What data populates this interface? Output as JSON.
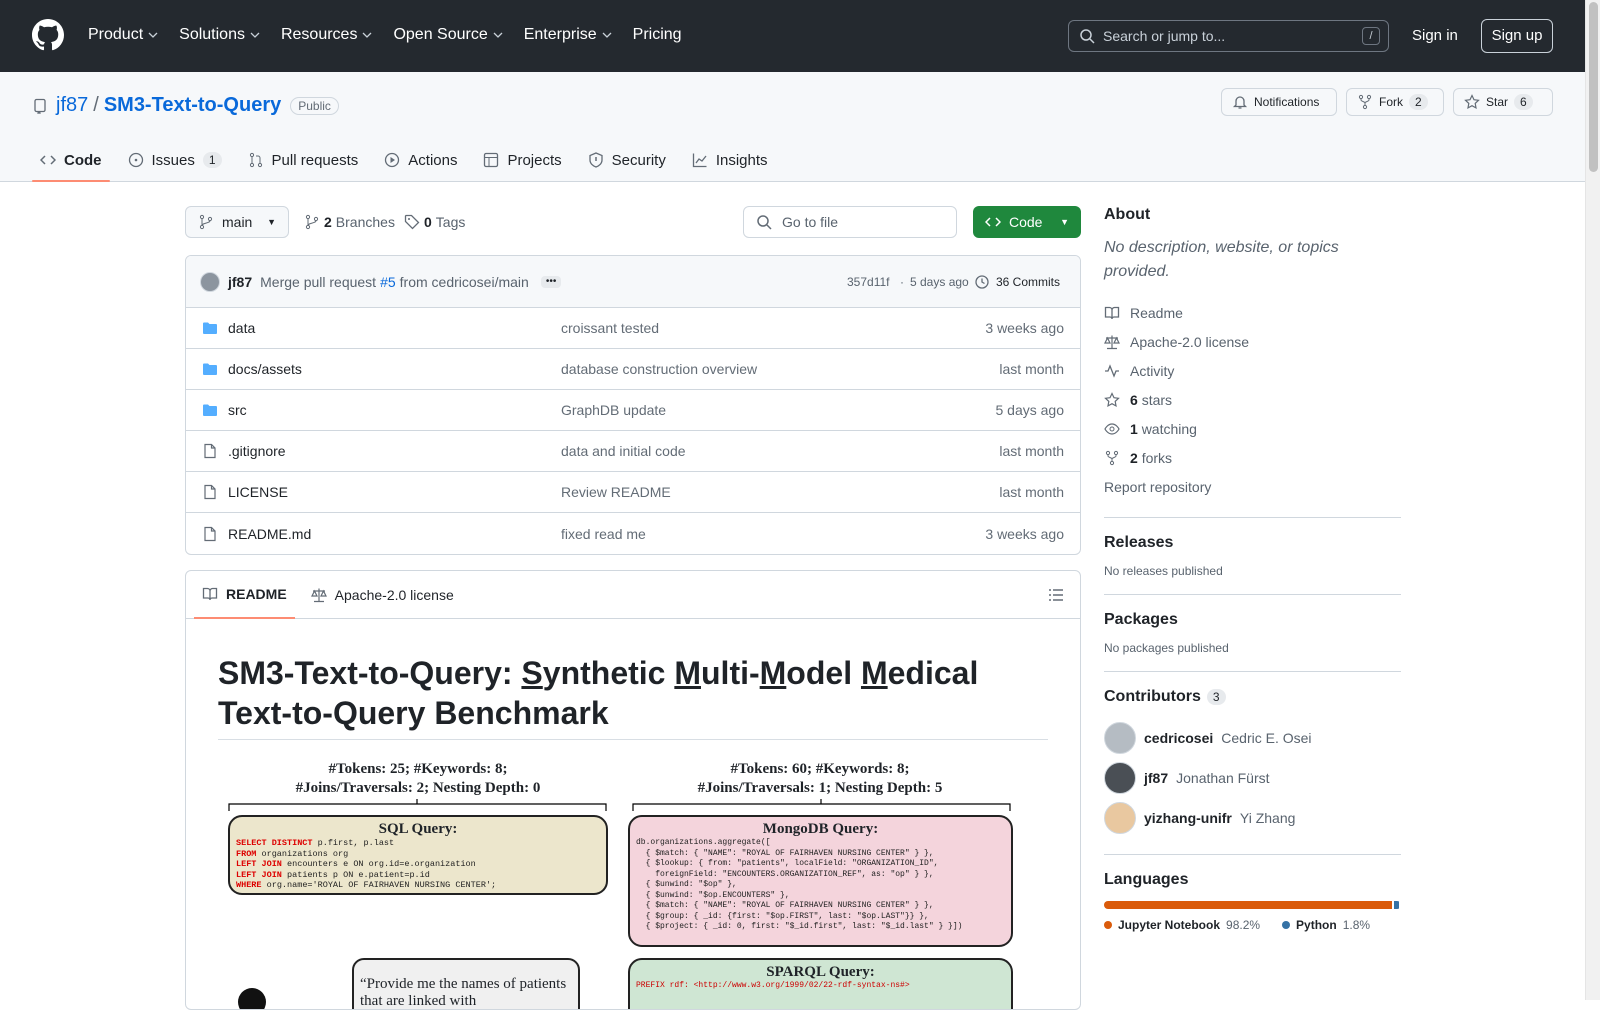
{
  "header": {
    "nav": [
      "Product",
      "Solutions",
      "Resources",
      "Open Source",
      "Enterprise",
      "Pricing"
    ],
    "search_placeholder": "Search or jump to...",
    "search_key": "/",
    "sign_in": "Sign in",
    "sign_up": "Sign up"
  },
  "repo": {
    "owner": "jf87",
    "sep": "/",
    "name": "SM3-Text-to-Query",
    "visibility": "Public",
    "notifications": "Notifications",
    "fork": "Fork",
    "fork_count": "2",
    "star": "Star",
    "star_count": "6"
  },
  "tabs": [
    {
      "label": "Code",
      "icon": "code-icon"
    },
    {
      "label": "Issues",
      "icon": "issue-icon",
      "count": "1"
    },
    {
      "label": "Pull requests",
      "icon": "pr-icon"
    },
    {
      "label": "Actions",
      "icon": "play-icon"
    },
    {
      "label": "Projects",
      "icon": "table-icon"
    },
    {
      "label": "Security",
      "icon": "shield-icon"
    },
    {
      "label": "Insights",
      "icon": "graph-icon"
    }
  ],
  "toolbar": {
    "branch": "main",
    "branches_count": "2",
    "branches_label": "Branches",
    "tags_count": "0",
    "tags_label": "Tags",
    "goto": "Go to file",
    "code": "Code"
  },
  "commit": {
    "author": "jf87",
    "message_prefix": "Merge pull request",
    "pr": "#5",
    "message_suffix": "from cedricosei/main",
    "sha": "357d11f",
    "dot": "·",
    "age": "5 days ago",
    "commits": "36 Commits"
  },
  "files": [
    {
      "name": "data",
      "type": "folder",
      "msg": "croissant tested",
      "age": "3 weeks ago"
    },
    {
      "name": "docs/assets",
      "type": "folder",
      "msg": "database construction overview",
      "age": "last month"
    },
    {
      "name": "src",
      "type": "folder",
      "msg": "GraphDB update",
      "age": "5 days ago"
    },
    {
      "name": ".gitignore",
      "type": "file",
      "msg": "data and initial code",
      "age": "last month"
    },
    {
      "name": "LICENSE",
      "type": "file",
      "msg": "Review README",
      "age": "last month"
    },
    {
      "name": "README.md",
      "type": "file",
      "msg": "fixed read me",
      "age": "3 weeks ago"
    }
  ],
  "readme": {
    "tab1": "README",
    "tab2": "Apache-2.0 license",
    "title_1": "SM3-Text-to-Query: ",
    "title_s": "S",
    "title_2": "ynthetic ",
    "title_m1": "M",
    "title_3": "ulti-",
    "title_m2": "M",
    "title_4": "odel ",
    "title_m3": "M",
    "title_5": "edical",
    "title_line2": "Text-to-Query Benchmark",
    "fig": {
      "left_stats1": "#Tokens: 25;  #Keywords: 8;",
      "left_stats2": "#Joins/Traversals: 2; Nesting Depth: 0",
      "right_stats1": "#Tokens: 60;  #Keywords: 8;",
      "right_stats2": "#Joins/Traversals: 1; Nesting Depth: 5",
      "sql_title": "SQL Query:",
      "sql_lines": [
        "SELECT DISTINCT p.first, p.last",
        "FROM organizations org",
        "LEFT JOIN encounters e ON org.id=e.organization",
        "LEFT JOIN patients p ON e.patient=p.id",
        "WHERE org.name='ROYAL OF FAIRHAVEN NURSING CENTER';"
      ],
      "mongo_title": "MongoDB Query:",
      "mongo_lines": [
        "db.organizations.aggregate([",
        "  { $match: { \"NAME\": \"ROYAL OF FAIRHAVEN NURSING CENTER\" } },",
        "  { $lookup: { from: \"patients\", localField: \"ORGANIZATION_ID\",",
        "    foreignField: \"ENCOUNTERS.ORGANIZATION_REF\", as: \"op\" } },",
        "  { $unwind: \"$op\" },",
        "  { $unwind: \"$op.ENCOUNTERS\" },",
        "  { $match: { \"NAME\": \"ROYAL OF FAIRHAVEN NURSING CENTER\" } },",
        "  { $group: { _id: {first: \"$op.FIRST\", last: \"$op.LAST\"}} },",
        "  { $project: { _id: 0, first: \"$_id.first\", last: \"$_id.last\" } }])"
      ],
      "quote": "“Provide me the names of patients that are linked with",
      "sparql_title": "SPARQL Query:",
      "sparql_line": "PREFIX rdf: <http://www.w3.org/1999/02/22-rdf-syntax-ns#>"
    }
  },
  "about": {
    "title": "About",
    "desc": "No description, website, or topics provided.",
    "links": [
      {
        "icon": "book-icon",
        "label": "Readme"
      },
      {
        "icon": "scale-icon",
        "label": "Apache-2.0 license"
      },
      {
        "icon": "pulse-icon",
        "label": "Activity"
      },
      {
        "icon": "star-icon",
        "count": "6",
        "label": "stars"
      },
      {
        "icon": "eye-icon",
        "count": "1",
        "label": "watching"
      },
      {
        "icon": "fork-icon",
        "count": "2",
        "label": "forks"
      }
    ],
    "report": "Report repository"
  },
  "releases": {
    "title": "Releases",
    "none": "No releases published"
  },
  "packages": {
    "title": "Packages",
    "none": "No packages published"
  },
  "contributors": {
    "title": "Contributors",
    "count": "3",
    "list": [
      {
        "login": "cedricosei",
        "name": "Cedric E. Osei"
      },
      {
        "login": "jf87",
        "name": "Jonathan Fürst"
      },
      {
        "login": "yizhang-unifr",
        "name": "Yi Zhang"
      }
    ]
  },
  "languages": {
    "title": "Languages",
    "list": [
      {
        "name": "Jupyter Notebook",
        "pct": "98.2%",
        "value": 98.2,
        "color": "#DA5B0B"
      },
      {
        "name": "Python",
        "pct": "1.8%",
        "value": 1.8,
        "color": "#3572A5"
      }
    ]
  }
}
